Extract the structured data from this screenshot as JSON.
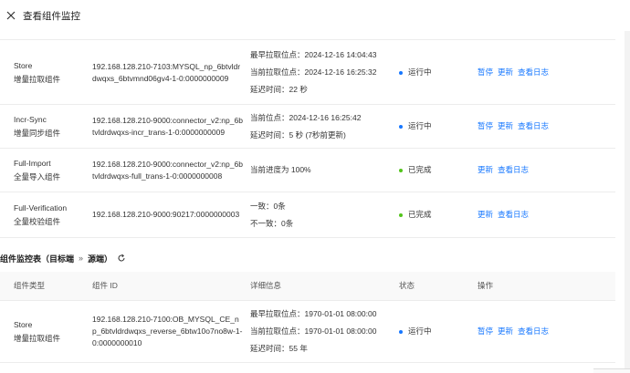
{
  "header": {
    "title": "查看组件监控"
  },
  "top_table": {
    "rows": [
      {
        "type_en": "Store",
        "type_cn": "增量拉取组件",
        "id": "192.168.128.210-7103:MYSQL_np_6btvldrdwqxs_6btvmnd06gv4-1-0:0000000009",
        "details": [
          "最早拉取位点：2024-12-16 14:04:43",
          "当前拉取位点：2024-12-16 16:25:32",
          "延迟时间：22 秒"
        ],
        "status": "运行中",
        "status_color": "#1677ff",
        "ops": [
          "暂停",
          "更新",
          "查看日志"
        ]
      },
      {
        "type_en": "Incr-Sync",
        "type_cn": "增量同步组件",
        "id": "192.168.128.210-9000:connector_v2:np_6btvldrdwqxs-incr_trans-1-0:0000000009",
        "details": [
          "当前位点：2024-12-16 16:25:42",
          "延迟时间：5 秒 (7秒前更新)"
        ],
        "status": "运行中",
        "status_color": "#1677ff",
        "ops": [
          "暂停",
          "更新",
          "查看日志"
        ]
      },
      {
        "type_en": "Full-Import",
        "type_cn": "全量导入组件",
        "id": "192.168.128.210-9000:connector_v2:np_6btvldrdwqxs-full_trans-1-0:0000000008",
        "details": [
          "当前进度为 100%"
        ],
        "status": "已完成",
        "status_color": "#52c41a",
        "ops": [
          "更新",
          "查看日志"
        ]
      },
      {
        "type_en": "Full-Verification",
        "type_cn": "全量校验组件",
        "id": "192.168.128.210-9000:90217:0000000003",
        "details": [
          "一致：0条",
          "不一致：0条"
        ],
        "status": "已完成",
        "status_color": "#52c41a",
        "ops": [
          "更新",
          "查看日志"
        ]
      }
    ]
  },
  "section": {
    "title": "组件监控表（目标端",
    "arrow": "»",
    "suffix": "源端）"
  },
  "bottom_table": {
    "headers": [
      "组件类型",
      "组件 ID",
      "详细信息",
      "状态",
      "操作"
    ],
    "rows": [
      {
        "type_en": "Store",
        "type_cn": "增量拉取组件",
        "id": "192.168.128.210-7100:OB_MYSQL_CE_np_6btvldrdwqxs_reverse_6btw10o7no8w-1-0:0000000010",
        "details": [
          "最早拉取位点：1970-01-01 08:00:00",
          "当前拉取位点：1970-01-01 08:00:00",
          "延迟时间：55 年"
        ],
        "status": "运行中",
        "status_color": "#1677ff",
        "ops": [
          "暂停",
          "更新",
          "查看日志"
        ]
      }
    ]
  }
}
